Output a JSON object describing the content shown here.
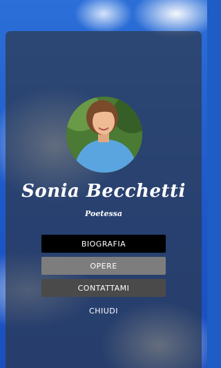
{
  "profile": {
    "name": "Sonia Becchetti",
    "subtitle": "Poetessa"
  },
  "menu": {
    "biografia": "BIOGRAFIA",
    "opere": "OPERE",
    "contattami": "CONTATTAMI",
    "chiudi": "CHIUDI"
  },
  "colors": {
    "background_sky": "#1e5cc6",
    "card_overlay": "#2d3746",
    "button_primary": "#000000",
    "button_secondary": "#7d7d7d",
    "button_tertiary": "#4a4a4a"
  }
}
